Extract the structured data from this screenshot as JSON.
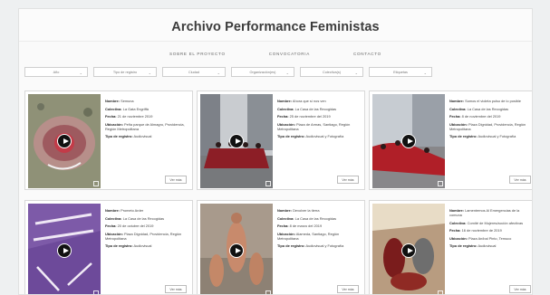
{
  "header": {
    "title": "Archivo Performance Feministas"
  },
  "nav": [
    {
      "label": "SOBRE EL PROYECTO"
    },
    {
      "label": "CONVOCATORIA"
    },
    {
      "label": "CONTACTO"
    }
  ],
  "filters": [
    {
      "label": "Año"
    },
    {
      "label": "Tipo de registro"
    },
    {
      "label": "Ciudad"
    },
    {
      "label": "Organización(es)"
    },
    {
      "label": "Colectiva(s)"
    },
    {
      "label": "Etiquetas"
    }
  ],
  "field_labels": {
    "name": "Nombre:",
    "collective": "Colectiva:",
    "date": "Fecha:",
    "location": "Ubicación:",
    "record_type": "Tipo de registro:"
  },
  "cards": [
    {
      "name": "Semuna",
      "collective": "La Gata Engriffá",
      "date": "21 de noviembre 2019",
      "location": "Peña parque de Almagro, Providencia, Región Metropolitana",
      "record_type": "Audiovisual",
      "button": "Ver más"
    },
    {
      "name": "Ahora que sí nos ven",
      "collective": "La Casa de las Recogidas",
      "date": "25 de noviembre del 2019",
      "location": "Plaza de Armas, Santiago, Región Metropolitana",
      "record_type": "Audiovisual y Fotografía",
      "button": "Ver más"
    },
    {
      "name": "Somos el violeta pulso de lo posible",
      "collective": "La Casa de las Recogidas",
      "date": "8 de noviembre del 2019",
      "location": "Plaza Dignidad, Providencia, Región Metropolitana",
      "record_type": "Audiovisual y Fotografía",
      "button": "Ver más"
    },
    {
      "name": "Prometo Arder",
      "collective": "La Casa de las Recogidas",
      "date": "20 de octubre del 2019",
      "location": "Plaza Dignidad, Providencia, Región Metropolitana",
      "record_type": "Audiovisual",
      "button": "Ver más"
    },
    {
      "name": "Devolver la tierra",
      "collective": "La Casa de las Recogidas",
      "date": "8 de marzo del 2019",
      "location": "Alameda, Santiago, Región Metropolitana",
      "record_type": "Audiovisual y Fotografía",
      "button": "Ver más"
    },
    {
      "name": "Lamentemos Al Emergencias de la comuna",
      "collective": "Comité de Mujeres/acción afectivas",
      "date": "16 de noviembre de 2019",
      "location": "Plaza Aníbal Pinto, Temuco",
      "record_type": "Audiovisual",
      "button": "Ver más"
    }
  ]
}
